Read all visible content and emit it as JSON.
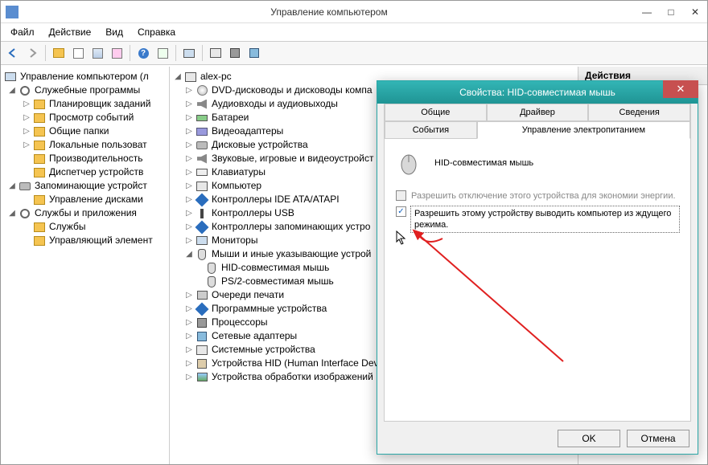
{
  "window": {
    "title": "Управление компьютером",
    "min": "—",
    "max": "□",
    "close": "✕"
  },
  "menu": {
    "file": "Файл",
    "action": "Действие",
    "view": "Вид",
    "help": "Справка"
  },
  "toolbar_icons": [
    "back",
    "forward",
    "up",
    "show",
    "props",
    "delete",
    "refresh",
    "export",
    "help",
    "sep",
    "view1",
    "sep",
    "dev1",
    "dev2",
    "dev3"
  ],
  "left_tree": {
    "root": "Управление компьютером (л",
    "groups": [
      {
        "label": "Служебные программы",
        "expanded": true,
        "children": [
          "Планировщик заданий",
          "Просмотр событий",
          "Общие папки",
          "Локальные пользоват",
          "Производительность",
          "Диспетчер устройств"
        ]
      },
      {
        "label": "Запоминающие устройст",
        "expanded": true,
        "children": [
          "Управление дисками"
        ]
      },
      {
        "label": "Службы и приложения",
        "expanded": true,
        "children": [
          "Службы",
          "Управляющий элемент"
        ]
      }
    ]
  },
  "mid_tree": {
    "root": "alex-pc",
    "items": [
      {
        "i": "dvd",
        "l": "DVD-дисководы и дисководы компа"
      },
      {
        "i": "sound",
        "l": "Аудиовходы и аудиовыходы"
      },
      {
        "i": "bat",
        "l": "Батареи"
      },
      {
        "i": "vid",
        "l": "Видеоадаптеры"
      },
      {
        "i": "disk",
        "l": "Дисковые устройства"
      },
      {
        "i": "sound",
        "l": "Звуковые, игровые и видеоустройст"
      },
      {
        "i": "kb",
        "l": "Клавиатуры"
      },
      {
        "i": "pc",
        "l": "Компьютер"
      },
      {
        "i": "cube",
        "l": "Контроллеры IDE ATA/ATAPI"
      },
      {
        "i": "usb",
        "l": "Контроллеры USB"
      },
      {
        "i": "cube",
        "l": "Контроллеры запоминающих устро"
      },
      {
        "i": "screen",
        "l": "Мониторы"
      },
      {
        "i": "mouse",
        "l": "Мыши и иные указывающие устрой",
        "expanded": true,
        "children": [
          {
            "i": "mouse",
            "l": "HID-совместимая мышь"
          },
          {
            "i": "mouse",
            "l": "PS/2-совместимая мышь"
          }
        ]
      },
      {
        "i": "print",
        "l": "Очереди печати"
      },
      {
        "i": "cube",
        "l": "Программные устройства"
      },
      {
        "i": "chip",
        "l": "Процессоры"
      },
      {
        "i": "net",
        "l": "Сетевые адаптеры"
      },
      {
        "i": "pc",
        "l": "Системные устройства"
      },
      {
        "i": "hid",
        "l": "Устройства HID (Human Interface Dev"
      },
      {
        "i": "img",
        "l": "Устройства обработки изображений"
      }
    ]
  },
  "right": {
    "header": "Действия"
  },
  "dialog": {
    "title": "Свойства: HID-совместимая мышь",
    "close": "✕",
    "tabs_row1": [
      "Общие",
      "Драйвер",
      "Сведения"
    ],
    "tabs_row2": [
      "События",
      "Управление электропитанием"
    ],
    "device_name": "HID-совместимая мышь",
    "chk1": "Разрешить отключение этого устройства для экономии энергии.",
    "chk2": "Разрешить этому устройству выводить компьютер из ждущего режима.",
    "ok": "OK",
    "cancel": "Отмена"
  }
}
